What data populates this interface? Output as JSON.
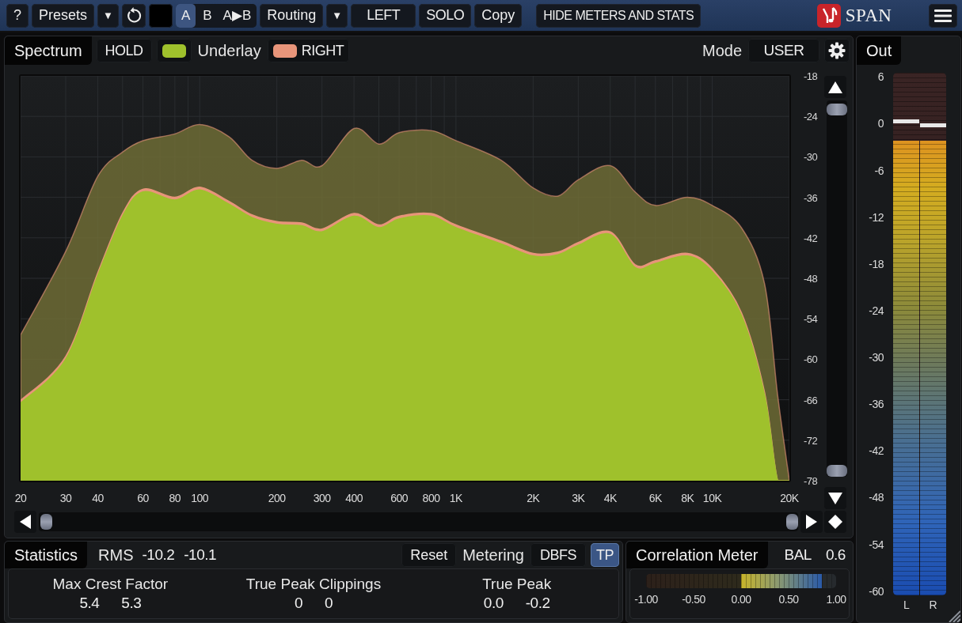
{
  "toolbar": {
    "help": "?",
    "presets": "Presets",
    "presets_caret": "▼",
    "ab": [
      {
        "label": "A",
        "selected": true
      },
      {
        "label": "B",
        "selected": false
      }
    ],
    "copy_ab": "A▶B",
    "routing": "Routing",
    "routing_caret": "▼",
    "channel": "LEFT",
    "solo": "SOLO",
    "copy": "Copy",
    "hide": "HIDE METERS AND STATS",
    "product": "SPAN"
  },
  "spectrum": {
    "tab": "Spectrum",
    "hold": "HOLD",
    "underlay_label": "Underlay",
    "mode_label": "Mode",
    "mode": "USER",
    "traces": [
      {
        "color": "#9fc12c"
      },
      {
        "label": "RIGHT",
        "color": "#e8957a"
      }
    ],
    "x_labels": [
      "20",
      "30",
      "40",
      "60",
      "80",
      "100",
      "200",
      "300",
      "400",
      "600",
      "800",
      "1K",
      "2K",
      "3K",
      "4K",
      "6K",
      "8K",
      "10K",
      "20K"
    ],
    "y_labels": [
      "-18",
      "-24",
      "-30",
      "-36",
      "-42",
      "-48",
      "-54",
      "-60",
      "-66",
      "-72",
      "-78"
    ]
  },
  "statistics": {
    "tab": "Statistics",
    "rms_label": "RMS",
    "rms": [
      "-10.2",
      "-10.1"
    ],
    "reset": "Reset",
    "metering_label": "Metering",
    "metering": "DBFS",
    "tp": {
      "label": "TP",
      "on": true
    },
    "columns": [
      {
        "label": "Max Crest Factor",
        "values": [
          "5.4",
          "5.3"
        ]
      },
      {
        "label": "True Peak Clippings",
        "values": [
          "0",
          "0"
        ]
      },
      {
        "label": "True Peak",
        "values": [
          "0.0",
          "-0.2"
        ]
      }
    ]
  },
  "correlation": {
    "tab": "Correlation Meter",
    "bal_label": "BAL",
    "bal": "0.6",
    "level": 0.925,
    "ticks": [
      "-1.00",
      "-0.50",
      "0.00",
      "0.50",
      "1.00"
    ]
  },
  "out": {
    "tab": "Out",
    "scale": [
      "6",
      "0",
      "-6",
      "-12",
      "-18",
      "-24",
      "-30",
      "-36",
      "-42",
      "-48",
      "-54",
      "-60"
    ],
    "channels": [
      {
        "label": "L",
        "level": 0.87,
        "hold": {
          "level": 0.903
        }
      },
      {
        "label": "R",
        "level": 0.87,
        "hold": {
          "level": 0.895
        }
      }
    ]
  }
}
